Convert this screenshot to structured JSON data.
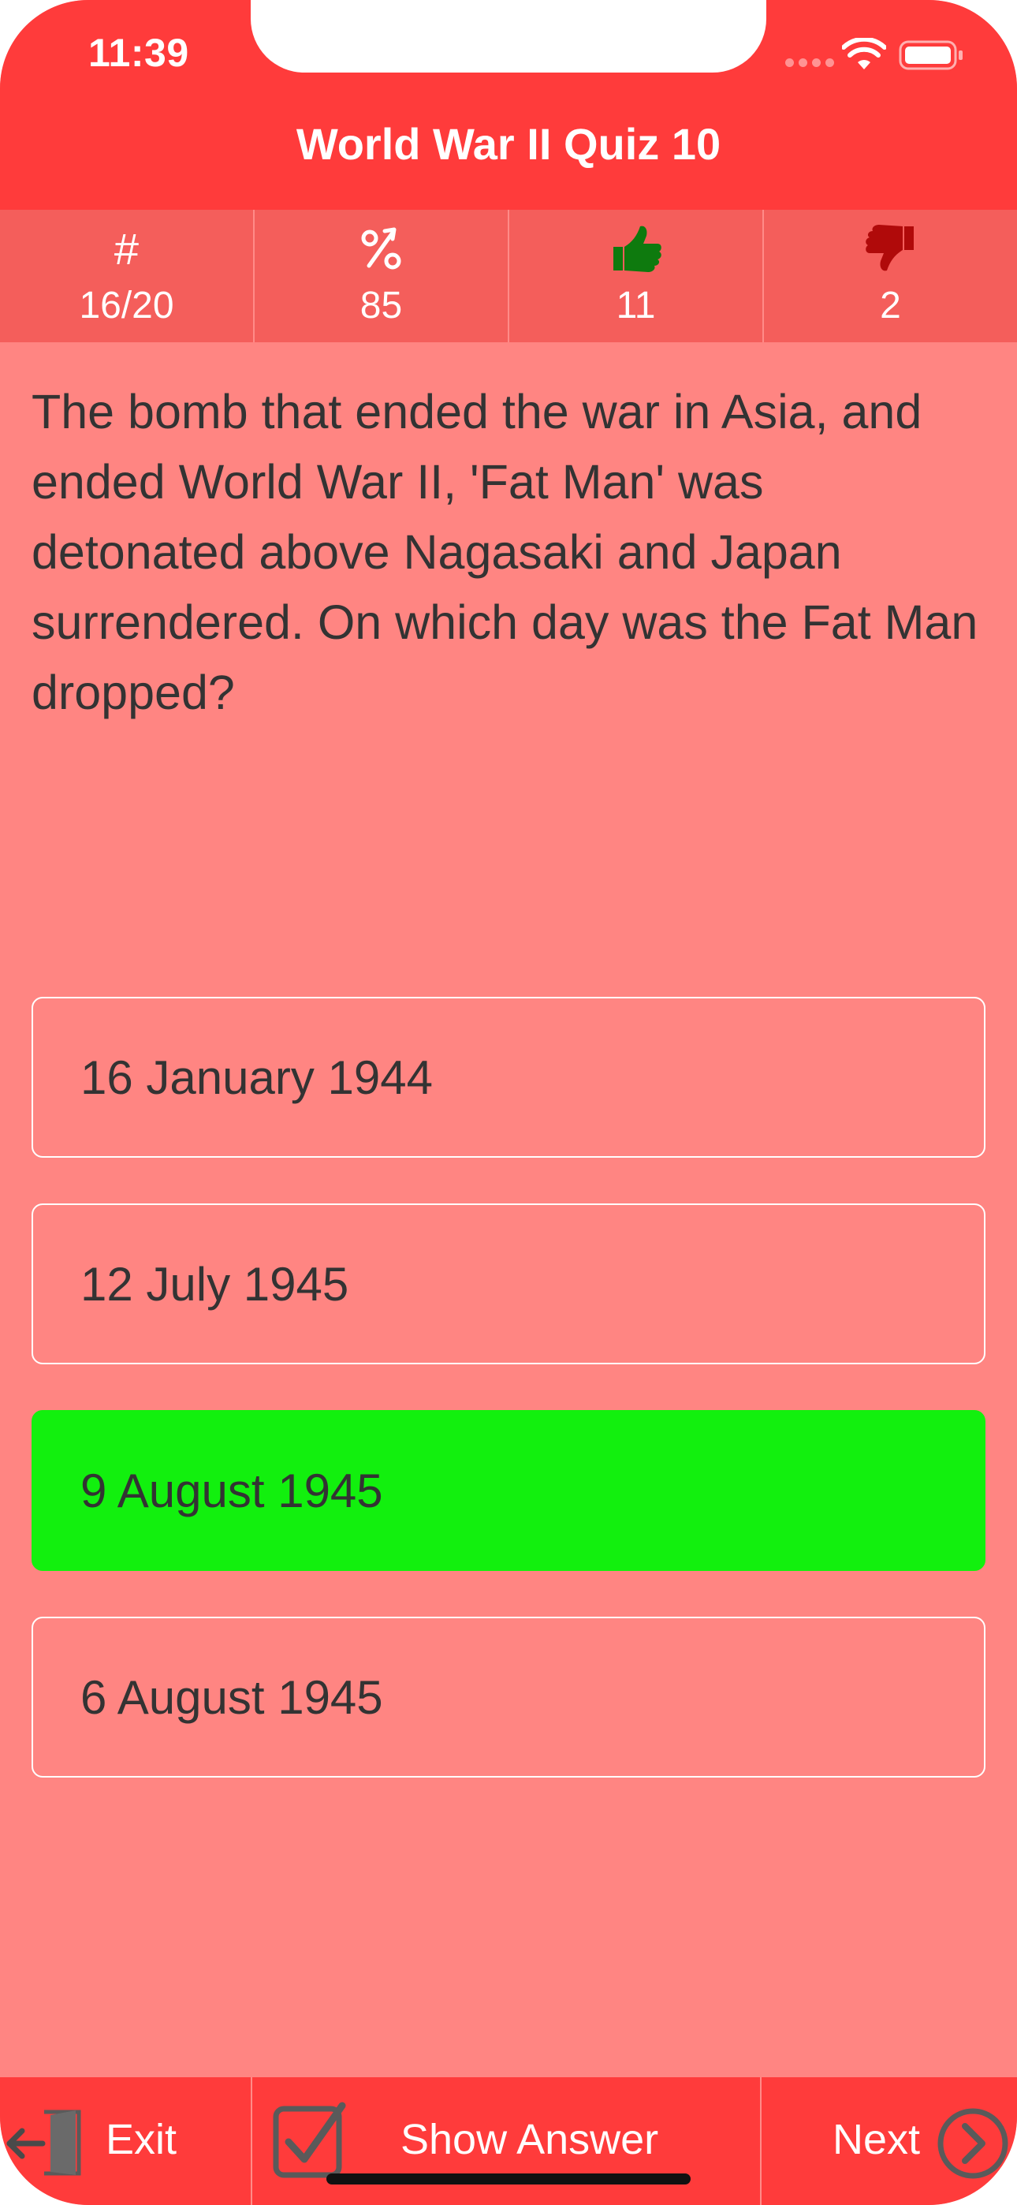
{
  "status_bar": {
    "time": "11:39"
  },
  "nav": {
    "title": "World War II Quiz 10"
  },
  "stats": [
    {
      "icon": "hash-icon",
      "symbol": "#",
      "value": "16/20"
    },
    {
      "icon": "percent-up-icon",
      "symbol": "%",
      "value": "85"
    },
    {
      "icon": "thumbs-up-icon",
      "value": "11"
    },
    {
      "icon": "thumbs-down-icon",
      "value": "2"
    }
  ],
  "question": "The bomb that ended the war in Asia, and ended World War II, 'Fat Man' was detonated above Nagasaki and Japan surrendered. On which day was the Fat Man dropped?",
  "answers": [
    {
      "label": "16 January 1944",
      "state": "normal"
    },
    {
      "label": "12 July 1945",
      "state": "normal"
    },
    {
      "label": "9 August 1945",
      "state": "correct"
    },
    {
      "label": "6 August 1945",
      "state": "normal"
    }
  ],
  "toolbar": {
    "exit_label": "Exit",
    "show_answer_label": "Show Answer",
    "next_label": "Next"
  },
  "colors": {
    "header": "#FF3B3B",
    "stats_bar": "#F45E5B",
    "background": "#FF8582",
    "correct": "#12F00E",
    "thumbs_up": "#0E7A0E",
    "thumbs_down": "#B00A0A"
  }
}
